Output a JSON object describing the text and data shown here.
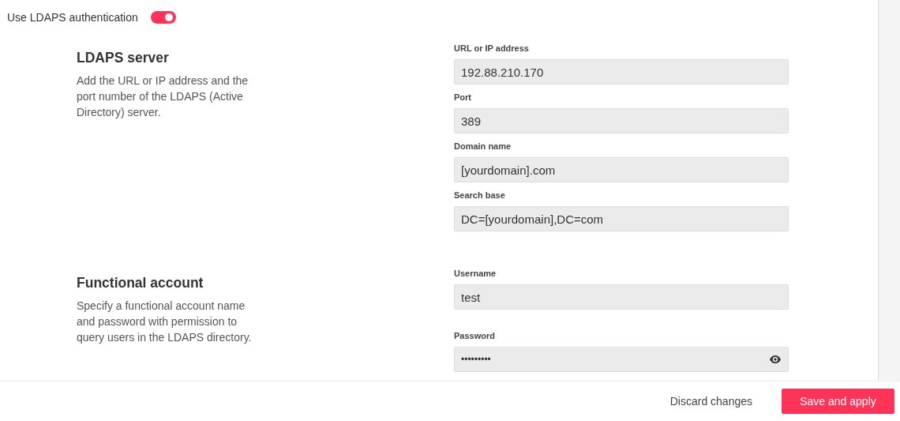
{
  "toggle": {
    "label": "Use LDAPS authentication",
    "on": true
  },
  "sections": [
    {
      "title": "LDAPS server",
      "description": "Add the URL or IP address and the port number of the LDAPS (Active Directory) server.",
      "fields": [
        {
          "label": "URL or IP address",
          "value": "192.88.210.170",
          "kind": "text"
        },
        {
          "label": "Port",
          "value": "389",
          "kind": "text"
        },
        {
          "label": "Domain name",
          "value": "[yourdomain].com",
          "kind": "text"
        },
        {
          "label": "Search base",
          "value": "DC=[yourdomain],DC=com",
          "kind": "text"
        }
      ]
    },
    {
      "title": "Functional account",
      "description": "Specify a functional account name and password with permission to query users in the LDAPS directory.",
      "fields": [
        {
          "label": "Username",
          "value": "test",
          "kind": "text"
        },
        {
          "label": "Password",
          "value": "•••••••••",
          "kind": "password"
        }
      ]
    }
  ],
  "footer": {
    "buttons": [
      {
        "label": "Discard changes",
        "kind": "secondary"
      },
      {
        "label": "Save and apply",
        "kind": "primary"
      }
    ]
  }
}
